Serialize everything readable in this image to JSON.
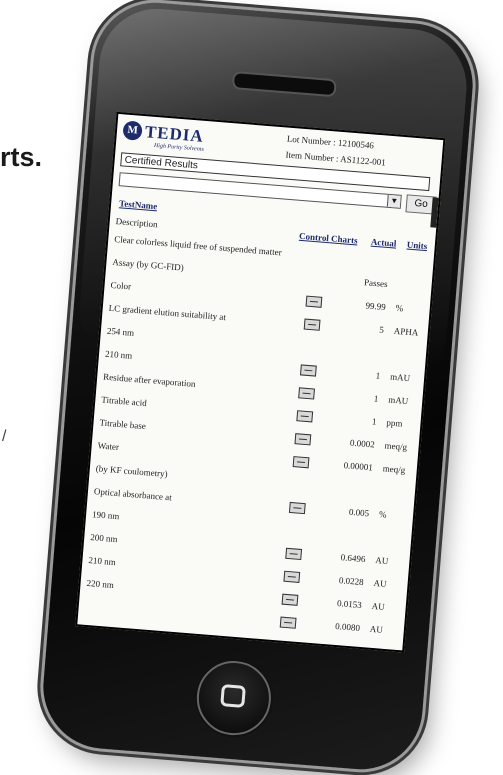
{
  "background": {
    "headline_fragment": "rts.",
    "side_mark": "/"
  },
  "header": {
    "logo_letter": "M",
    "logo_name": "TEDIA",
    "logo_tagline": "High Purity Solvents",
    "lot_number": "Lot Number : 12100546",
    "item_number": "Item Number : AS1122-001"
  },
  "certified_results_label": "Certified Results",
  "go_button": "Go",
  "columns": {
    "test_name": "TestName",
    "description": "Description",
    "control_charts": "Control Charts",
    "actual": "Actual",
    "units": "Units"
  },
  "rows": [
    {
      "desc": "Clear colorless liquid free of suspended matter",
      "chart": false,
      "actual": "",
      "units": ""
    },
    {
      "desc": "Assay (by GC-FID)",
      "chart": false,
      "actual": "Passes",
      "units": ""
    },
    {
      "desc": "Color",
      "chart": true,
      "actual": "99.99",
      "units": "%"
    },
    {
      "desc": "LC gradient elution suitability at",
      "chart": true,
      "actual": "5",
      "units": "APHA"
    },
    {
      "desc": "254 nm",
      "chart": false,
      "actual": "",
      "units": ""
    },
    {
      "desc": "210 nm",
      "chart": true,
      "actual": "1",
      "units": "mAU"
    },
    {
      "desc": "Residue after evaporation",
      "chart": true,
      "actual": "1",
      "units": "mAU"
    },
    {
      "desc": "Titrable acid",
      "chart": true,
      "actual": "1",
      "units": "ppm"
    },
    {
      "desc": "Titrable base",
      "chart": true,
      "actual": "0.0002",
      "units": "meq/g"
    },
    {
      "desc": "Water",
      "chart": true,
      "actual": "0.00001",
      "units": "meq/g"
    },
    {
      "desc": "(by KF coulometry)",
      "chart": false,
      "actual": "",
      "units": ""
    },
    {
      "desc": "Optical absorbance at",
      "chart": true,
      "actual": "0.005",
      "units": "%"
    },
    {
      "desc": "190 nm",
      "chart": false,
      "actual": "",
      "units": ""
    },
    {
      "desc": "200 nm",
      "chart": true,
      "actual": "0.6496",
      "units": "AU"
    },
    {
      "desc": "210 nm",
      "chart": true,
      "actual": "0.0228",
      "units": "AU"
    },
    {
      "desc": "220 nm",
      "chart": true,
      "actual": "0.0153",
      "units": "AU"
    },
    {
      "desc": "",
      "chart": true,
      "actual": "0.0080",
      "units": "AU"
    }
  ],
  "icons": {
    "home_button": "home-icon",
    "chart": "chart-icon",
    "dropdown": "chevron-down-icon"
  }
}
